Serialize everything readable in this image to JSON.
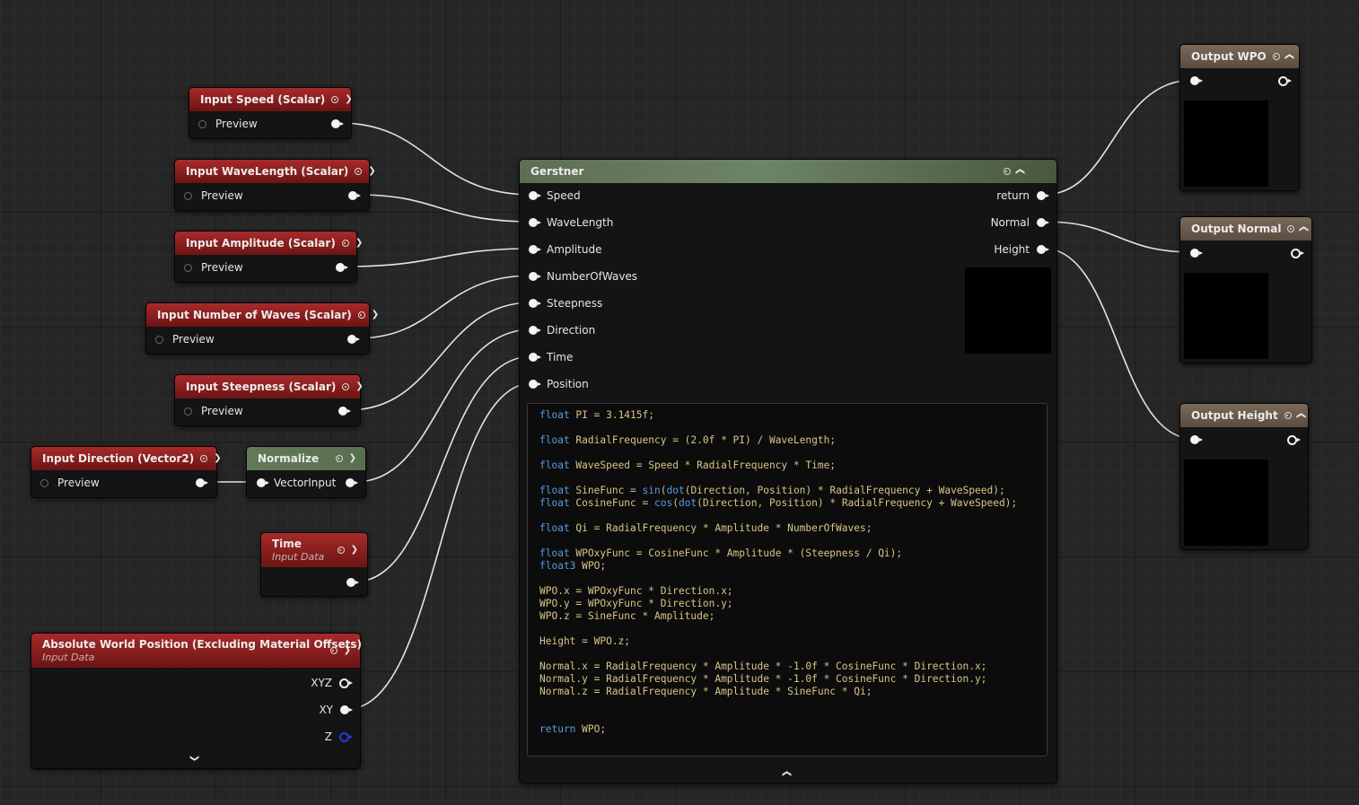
{
  "nodes": {
    "speed": {
      "title": "Input Speed (Scalar)",
      "pin": "Preview"
    },
    "wavelength": {
      "title": "Input WaveLength (Scalar)",
      "pin": "Preview"
    },
    "amplitude": {
      "title": "Input Amplitude (Scalar)",
      "pin": "Preview"
    },
    "numwaves": {
      "title": "Input Number of Waves (Scalar)",
      "pin": "Preview"
    },
    "steepness": {
      "title": "Input Steepness (Scalar)",
      "pin": "Preview"
    },
    "direction": {
      "title": "Input Direction (Vector2)",
      "pin": "Preview"
    },
    "normalize": {
      "title": "Normalize",
      "pin": "VectorInput"
    },
    "time": {
      "title": "Time",
      "subtitle": "Input Data"
    },
    "awp": {
      "title": "Absolute World Position (Excluding Material Offsets)",
      "subtitle": "Input Data",
      "pins": [
        "XYZ",
        "XY",
        "Z"
      ]
    },
    "gerstner": {
      "title": "Gerstner",
      "inputs": [
        "Speed",
        "WaveLength",
        "Amplitude",
        "NumberOfWaves",
        "Steepness",
        "Direction",
        "Time",
        "Position"
      ],
      "outputs": [
        "return",
        "Normal",
        "Height"
      ],
      "code": [
        [
          [
            "kw",
            "float"
          ],
          [
            "t",
            " PI = 3.1415f;"
          ]
        ],
        [],
        [
          [
            "kw",
            "float"
          ],
          [
            "t",
            " RadialFrequency = (2.0f * PI) / WaveLength;"
          ]
        ],
        [],
        [
          [
            "kw",
            "float"
          ],
          [
            "t",
            " WaveSpeed = Speed * RadialFrequency * Time;"
          ]
        ],
        [],
        [
          [
            "kw",
            "float"
          ],
          [
            "t",
            " SineFunc = "
          ],
          [
            "kw",
            "sin"
          ],
          [
            "t",
            "("
          ],
          [
            "kw",
            "dot"
          ],
          [
            "t",
            "(Direction, Position) * RadialFrequency + WaveSpeed);"
          ]
        ],
        [
          [
            "kw",
            "float"
          ],
          [
            "t",
            " CosineFunc = "
          ],
          [
            "kw",
            "cos"
          ],
          [
            "t",
            "("
          ],
          [
            "kw",
            "dot"
          ],
          [
            "t",
            "(Direction, Position) * RadialFrequency + WaveSpeed);"
          ]
        ],
        [],
        [
          [
            "kw",
            "float"
          ],
          [
            "t",
            " Qi = RadialFrequency * Amplitude * NumberOfWaves;"
          ]
        ],
        [],
        [
          [
            "kw",
            "float"
          ],
          [
            "t",
            " WPOxyFunc = CosineFunc * Amplitude * (Steepness / Qi);"
          ]
        ],
        [
          [
            "kw",
            "float3"
          ],
          [
            "t",
            " WPO;"
          ]
        ],
        [],
        [
          [
            "t",
            "WPO.x = WPOxyFunc * Direction.x;"
          ]
        ],
        [
          [
            "t",
            "WPO.y = WPOxyFunc * Direction.y;"
          ]
        ],
        [
          [
            "t",
            "WPO.z = SineFunc * Amplitude;"
          ]
        ],
        [],
        [
          [
            "t",
            "Height = WPO.z;"
          ]
        ],
        [],
        [
          [
            "t",
            "Normal.x = RadialFrequency * Amplitude * -1.0f * CosineFunc * Direction.x;"
          ]
        ],
        [
          [
            "t",
            "Normal.y = RadialFrequency * Amplitude * -1.0f * CosineFunc * Direction.y;"
          ]
        ],
        [
          [
            "t",
            "Normal.z = RadialFrequency * Amplitude * SineFunc * Qi;"
          ]
        ],
        [],
        [],
        [
          [
            "t",
            "return"
          ],
          [
            "t",
            " WPO;"
          ]
        ]
      ]
    },
    "out_wpo": {
      "title": "Output WPO"
    },
    "out_normal": {
      "title": "Output Normal"
    },
    "out_height": {
      "title": "Output Height"
    }
  }
}
